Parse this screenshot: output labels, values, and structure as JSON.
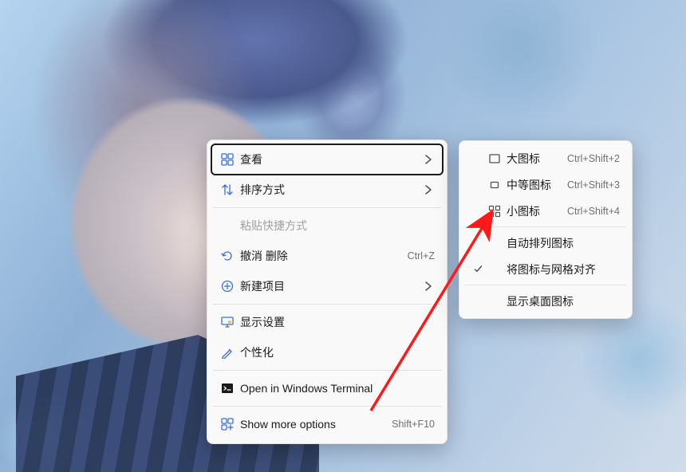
{
  "context_menu": {
    "items": [
      {
        "id": "view",
        "label": "查看",
        "icon": "view-icon",
        "hasSubmenu": true,
        "highlighted": true
      },
      {
        "id": "sort",
        "label": "排序方式",
        "icon": "sort-icon",
        "hasSubmenu": true
      },
      {
        "separator": true
      },
      {
        "id": "paste-shortcut",
        "label": "粘贴快捷方式",
        "disabled": true
      },
      {
        "id": "undo-delete",
        "label": "撤消 删除",
        "icon": "undo-icon",
        "shortcut": "Ctrl+Z"
      },
      {
        "id": "new",
        "label": "新建项目",
        "icon": "new-icon",
        "hasSubmenu": true
      },
      {
        "separator": true
      },
      {
        "id": "display-settings",
        "label": "显示设置",
        "icon": "display-icon"
      },
      {
        "id": "personalize",
        "label": "个性化",
        "icon": "personalize-icon"
      },
      {
        "separator": true
      },
      {
        "id": "terminal",
        "label": "Open in Windows Terminal",
        "icon": "terminal-icon"
      },
      {
        "separator": true
      },
      {
        "id": "show-more",
        "label": "Show more options",
        "icon": "more-icon",
        "shortcut": "Shift+F10"
      }
    ]
  },
  "submenu": {
    "items": [
      {
        "id": "large-icons",
        "label": "大图标",
        "icon": "large-rect-icon",
        "shortcut": "Ctrl+Shift+2"
      },
      {
        "id": "medium-icons",
        "label": "中等图标",
        "icon": "medium-rect-icon",
        "shortcut": "Ctrl+Shift+3"
      },
      {
        "id": "small-icons",
        "label": "小图标",
        "icon": "grid-small-icon",
        "shortcut": "Ctrl+Shift+4"
      },
      {
        "separator": true
      },
      {
        "id": "auto-arrange",
        "label": "自动排列图标"
      },
      {
        "id": "align-to-grid",
        "label": "将图标与网格对齐",
        "checked": true
      },
      {
        "separator": true
      },
      {
        "id": "show-desktop-icons",
        "label": "显示桌面图标"
      }
    ]
  },
  "annotation": {
    "target": "small-icons"
  }
}
